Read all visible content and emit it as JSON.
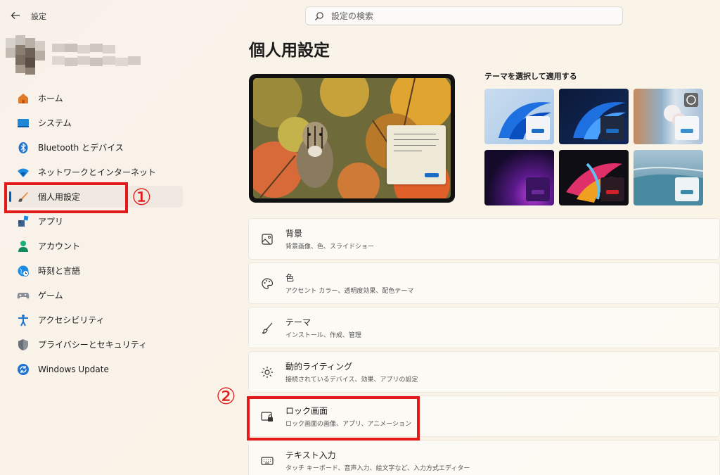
{
  "app": {
    "title": "設定",
    "back_icon": "back-arrow-icon"
  },
  "search": {
    "placeholder": "設定の検索",
    "value": ""
  },
  "page": {
    "title": "個人用設定"
  },
  "sidebar": {
    "items": [
      {
        "label": "ホーム",
        "icon": "home-icon",
        "active": false
      },
      {
        "label": "システム",
        "icon": "system-icon",
        "active": false
      },
      {
        "label": "Bluetooth とデバイス",
        "icon": "bluetooth-icon",
        "active": false
      },
      {
        "label": "ネットワークとインターネット",
        "icon": "network-icon",
        "active": false
      },
      {
        "label": "個人用設定",
        "icon": "brush-icon",
        "active": true
      },
      {
        "label": "アプリ",
        "icon": "apps-icon",
        "active": false
      },
      {
        "label": "アカウント",
        "icon": "account-icon",
        "active": false
      },
      {
        "label": "時刻と言語",
        "icon": "globe-clock-icon",
        "active": false
      },
      {
        "label": "ゲーム",
        "icon": "gamepad-icon",
        "active": false
      },
      {
        "label": "アクセシビリティ",
        "icon": "accessibility-icon",
        "active": false
      },
      {
        "label": "プライバシーとセキュリティ",
        "icon": "shield-icon",
        "active": false
      },
      {
        "label": "Windows Update",
        "icon": "update-icon",
        "active": false
      }
    ]
  },
  "themes": {
    "label": "テーマを選択して適用する",
    "cards": [
      {
        "name": "windows-light",
        "accent": "#1a6fc5"
      },
      {
        "name": "windows-dark",
        "accent": "#1a6fc5"
      },
      {
        "name": "spotlight",
        "accent": "#3a8fd0"
      },
      {
        "name": "glow",
        "accent": "#6a2a9a"
      },
      {
        "name": "captured-motion",
        "accent": "#d0202a"
      },
      {
        "name": "flow",
        "accent": "#3a8aaa"
      }
    ]
  },
  "settings": [
    {
      "title": "背景",
      "desc": "背景画像、色、スライドショー",
      "icon": "picture-icon"
    },
    {
      "title": "色",
      "desc": "アクセント カラー、透明度効果、配色テーマ",
      "icon": "palette-icon"
    },
    {
      "title": "テーマ",
      "desc": "インストール、作成、管理",
      "icon": "brush-icon"
    },
    {
      "title": "動的ライティング",
      "desc": "接続されているデバイス、効果、アプリの設定",
      "icon": "lighting-icon"
    },
    {
      "title": "ロック画面",
      "desc": "ロック画面の画像、アプリ、アニメーション",
      "icon": "lock-screen-icon"
    },
    {
      "title": "テキスト入力",
      "desc": "タッチ キーボード、音声入力、絵文字など、入力方式エディター",
      "icon": "keyboard-icon"
    }
  ],
  "annotations": {
    "one": "①",
    "two": "②",
    "color": "#e21a1a"
  },
  "colors": {
    "accent": "#005fb8",
    "highlight": "#e21a1a"
  }
}
